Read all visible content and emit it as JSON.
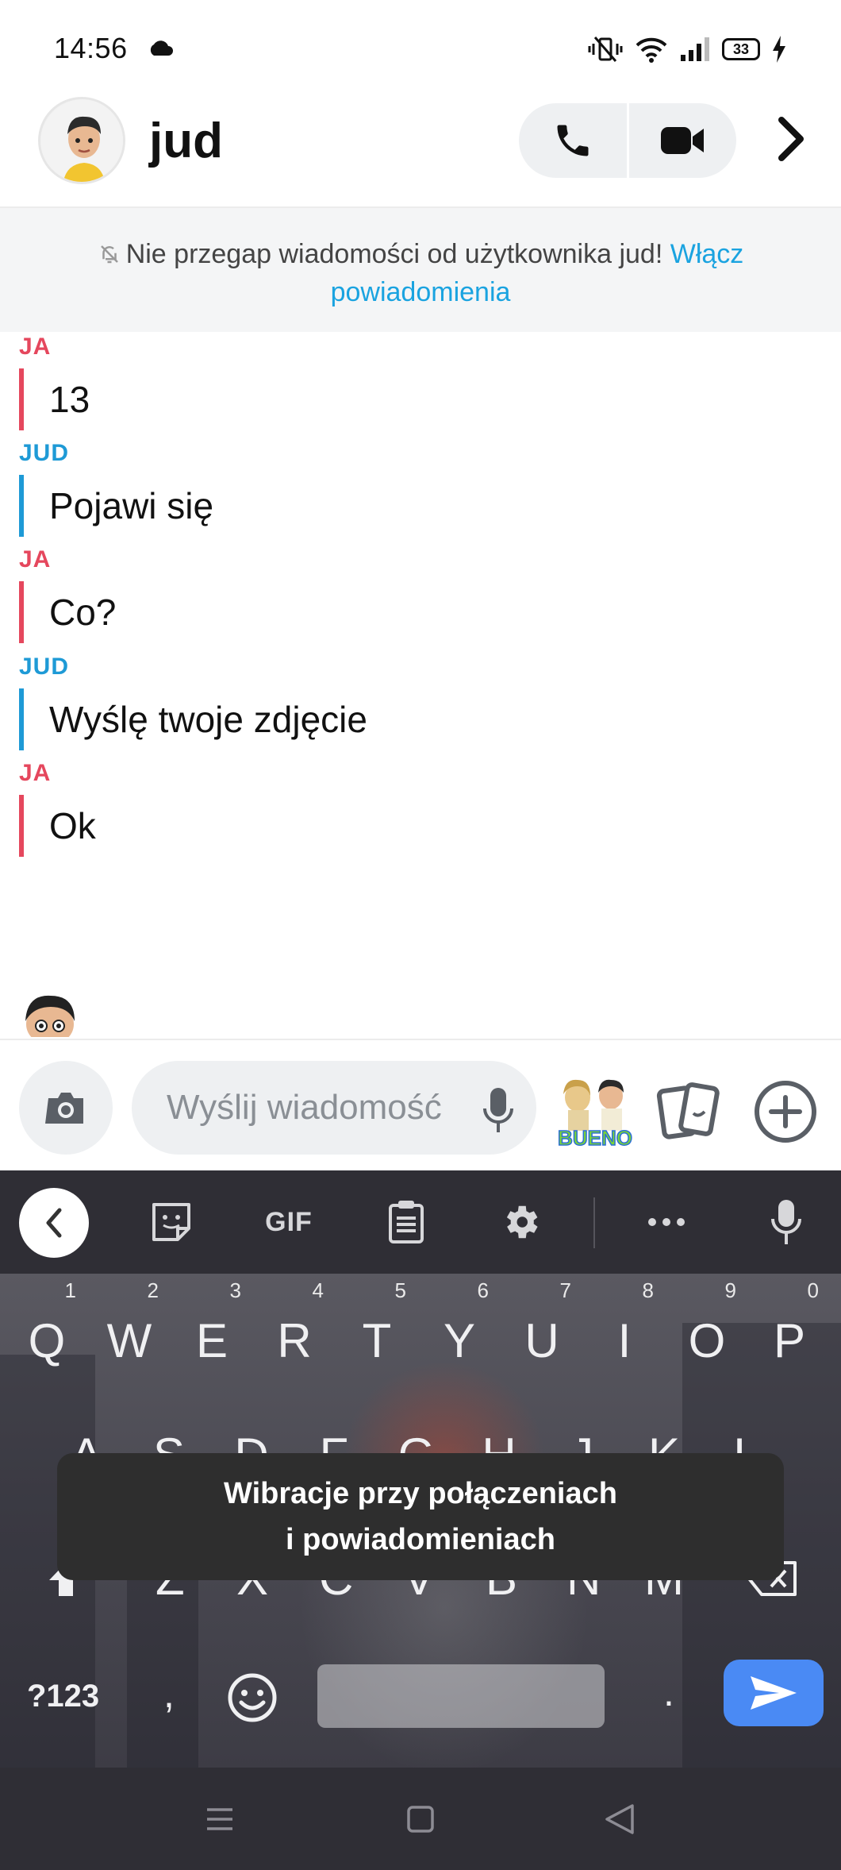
{
  "status_bar": {
    "time": "14:56",
    "battery": "33"
  },
  "header": {
    "contact_name": "jud"
  },
  "banner": {
    "text": "Nie przegap wiadomości od użytkownika jud!",
    "link": "Włącz powiadomienia"
  },
  "messages": [
    {
      "sender": "JA",
      "from": "me",
      "text": "13"
    },
    {
      "sender": "JUD",
      "from": "them",
      "text": "Pojawi się"
    },
    {
      "sender": "JA",
      "from": "me",
      "text": "Co?"
    },
    {
      "sender": "JUD",
      "from": "them",
      "text": "Wyślę twoje zdjęcie"
    },
    {
      "sender": "JA",
      "from": "me",
      "text": "Ok"
    }
  ],
  "composer": {
    "placeholder": "Wyślij wiadomość"
  },
  "keyboard": {
    "toolbar": {
      "gif_label": "GIF"
    },
    "row1": [
      {
        "key": "Q",
        "hint": "1"
      },
      {
        "key": "W",
        "hint": "2"
      },
      {
        "key": "E",
        "hint": "3"
      },
      {
        "key": "R",
        "hint": "4"
      },
      {
        "key": "T",
        "hint": "5"
      },
      {
        "key": "Y",
        "hint": "6"
      },
      {
        "key": "U",
        "hint": "7"
      },
      {
        "key": "I",
        "hint": "8"
      },
      {
        "key": "O",
        "hint": "9"
      },
      {
        "key": "P",
        "hint": "0"
      }
    ],
    "row2": [
      "A",
      "S",
      "D",
      "F",
      "G",
      "H",
      "J",
      "K",
      "L"
    ],
    "row3": [
      "Z",
      "X",
      "C",
      "V",
      "B",
      "N",
      "M"
    ],
    "symbols_label": "?123",
    "comma_label": ",",
    "period_label": "."
  },
  "toast": {
    "line1": "Wibracje przy połączeniach",
    "line2": "i powiadomieniach"
  },
  "colors": {
    "me_accent": "#e5475d",
    "them_accent": "#1e9ad6",
    "link": "#1aa3e0",
    "send_key": "#4a8af4"
  }
}
